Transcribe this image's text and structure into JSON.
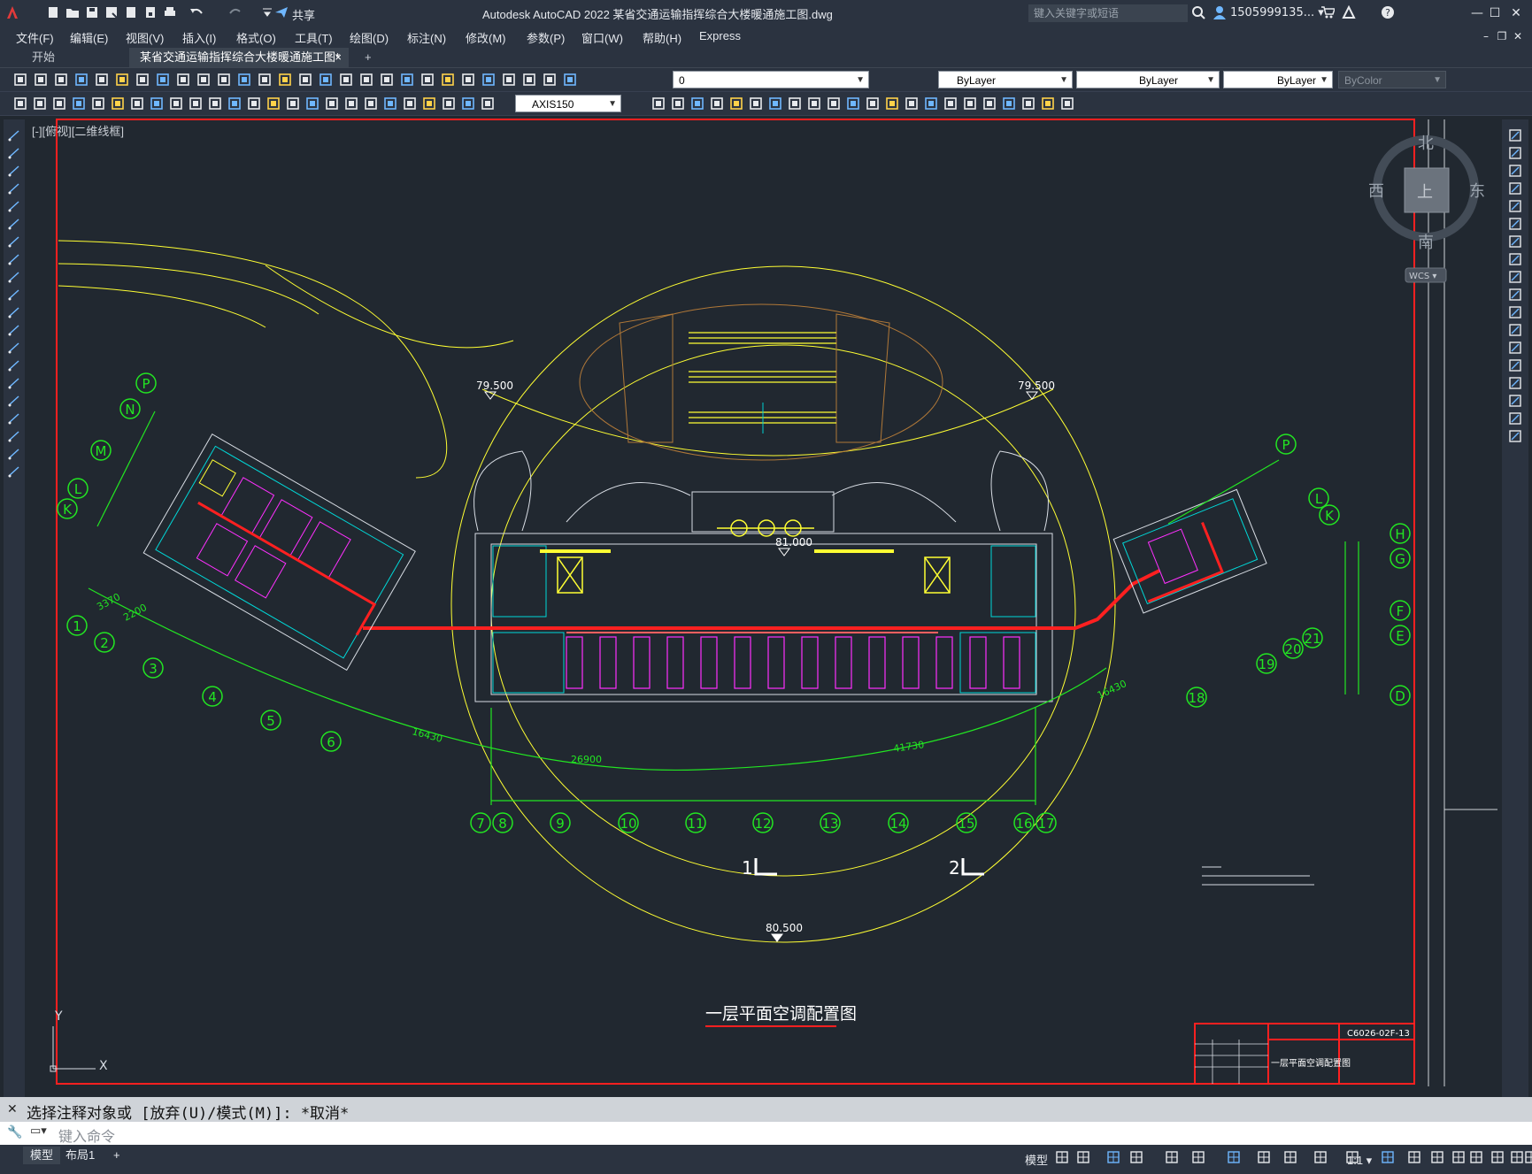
{
  "app": {
    "title": "Autodesk AutoCAD 2022    某省交通运输指挥综合大楼暖通施工图.dwg",
    "share_label": "共享",
    "search_placeholder": "键入关键字或短语",
    "user": "1505999135... ▾"
  },
  "menu": [
    "文件(F)",
    "编辑(E)",
    "视图(V)",
    "插入(I)",
    "格式(O)",
    "工具(T)",
    "绘图(D)",
    "标注(N)",
    "修改(M)",
    "参数(P)",
    "窗口(W)",
    "帮助(H)",
    "Express"
  ],
  "tabs": {
    "start": "开始",
    "active": "某省交通运输指挥综合大楼暖通施工图*",
    "close": "×",
    "new": "+"
  },
  "toolbar": {
    "layer_value": "0",
    "color_value": "ByLayer",
    "linetype_value": "ByLayer",
    "lineweight_value": "ByLayer",
    "plotstyle_value": "ByColor",
    "dimstyle_value": "AXIS150"
  },
  "viewport": {
    "label": "[-][俯视][二维线框]"
  },
  "viewcube": {
    "north": "北",
    "south": "南",
    "east": "东",
    "west": "西",
    "top": "上",
    "wcs": "WCS ▾"
  },
  "drawing": {
    "title": "一层平面空调配置图",
    "elevations": [
      "79.500",
      "79.500",
      "81.000",
      "80.500"
    ],
    "axes_bottom": [
      "7",
      "8",
      "9",
      "10",
      "11",
      "12",
      "13",
      "14",
      "15",
      "16",
      "17"
    ],
    "axes_left_num": [
      "1",
      "2",
      "3",
      "4",
      "5",
      "6"
    ],
    "axes_left_letters": [
      "P",
      "N",
      "M",
      "L",
      "K"
    ],
    "axes_right_letters": [
      "P",
      "L",
      "K"
    ],
    "axes_right_num": [
      "18",
      "19",
      "20",
      "21"
    ],
    "axes_far_right": [
      "H",
      "G",
      "F",
      "E",
      "D"
    ],
    "dims": [
      "3370",
      "2200",
      "16430",
      "26900",
      "41730",
      "16430"
    ],
    "sections": [
      "1",
      "2"
    ],
    "drawing_no": "C6026-02F-13",
    "titleblock_name": "一层平面空调配置图",
    "ucs_x": "X",
    "ucs_y": "Y"
  },
  "command": {
    "history": "选择注释对象或 [放弃(U)/模式(M)]: *取消*",
    "placeholder": "键入命令"
  },
  "status": {
    "model_tab": "模型",
    "layout_tab": "布局1",
    "add": "+",
    "model_btn": "模型",
    "scale": "1:1 ▾"
  }
}
